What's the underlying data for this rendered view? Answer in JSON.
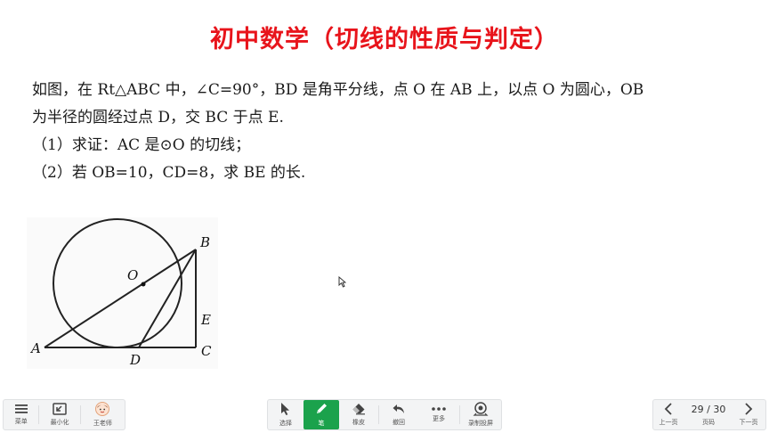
{
  "slide": {
    "title": "初中数学（切线的性质与判定）",
    "problem": {
      "line1": "如图，在 Rt△ABC 中，∠C=90°，BD 是角平分线，点 O 在 AB 上，以点 O 为圆心，OB",
      "line2": "为半径的圆经过点 D，交 BC 于点 E.",
      "line3": "（1）求证：AC 是⊙O 的切线；",
      "line4": "（2）若 OB=10，CD=8，求 BE 的长."
    },
    "figure_labels": {
      "A": "A",
      "B": "B",
      "C": "C",
      "D": "D",
      "E": "E",
      "O": "O"
    }
  },
  "toolbar": {
    "left": [
      {
        "label": "菜单",
        "icon": "menu-icon"
      },
      {
        "label": "最小化",
        "icon": "minimize-icon"
      },
      {
        "label": "王老师",
        "icon": "avatar"
      }
    ],
    "center": [
      {
        "label": "选择",
        "icon": "cursor-icon"
      },
      {
        "label": "笔",
        "icon": "pen-icon"
      },
      {
        "label": "橡皮",
        "icon": "eraser-icon"
      },
      {
        "label": "撤回",
        "icon": "undo-icon"
      },
      {
        "label": "更多",
        "icon": "more-icon"
      },
      {
        "label": "录制投屏",
        "icon": "record-icon"
      }
    ],
    "pager": {
      "prev": "上一页",
      "page": "29 / 30",
      "page_label": "页码",
      "next": "下一页"
    }
  }
}
